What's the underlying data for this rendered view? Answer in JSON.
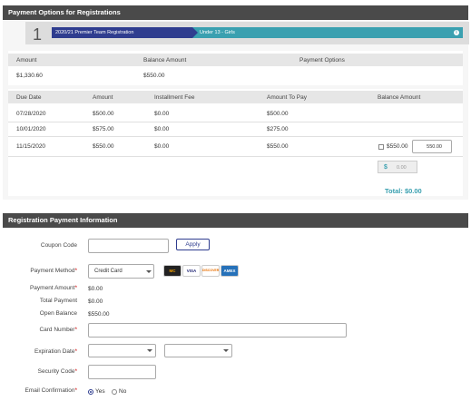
{
  "payment_options": {
    "header": "Payment Options for Registrations",
    "step_number": "1",
    "registration_name": "2020/21 Premier Team Registration",
    "division": "Under 13 - Girls",
    "info_icon": "i",
    "summary_headers": [
      "Amount",
      "Balance Amount",
      "Payment Options"
    ],
    "summary_values": [
      "$1,330.60",
      "$550.00",
      ""
    ],
    "schedule_headers": [
      "Due Date",
      "Amount",
      "Installment Fee",
      "Amount To Pay",
      "Balance Amount"
    ],
    "schedule_rows": [
      {
        "due": "07/28/2020",
        "amount": "$500.00",
        "fee": "$0.00",
        "to_pay": "$500.00"
      },
      {
        "due": "10/01/2020",
        "amount": "$575.00",
        "fee": "$0.00",
        "to_pay": "$275.00"
      },
      {
        "due": "11/15/2020",
        "amount": "$550.00",
        "fee": "$0.00",
        "to_pay": "$550.00"
      }
    ],
    "balance_checkbox_label": "$550.00",
    "balance_input_value": "550.00",
    "dollar_symbol": "$",
    "dollar_value": "0.00",
    "total": "Total: $0.00"
  },
  "registration_payment": {
    "header": "Registration Payment Information",
    "coupon_label": "Coupon Code",
    "coupon_value": "",
    "apply_button": "Apply",
    "payment_method_label": "Payment Method",
    "payment_method_value": "Credit Card",
    "card_logos": [
      "MC",
      "VISA",
      "DISCOVER",
      "AMEX"
    ],
    "payment_amount_label": "Payment Amount",
    "payment_amount_value": "$0.00",
    "total_payment_label": "Total Payment",
    "total_payment_value": "$0.00",
    "open_balance_label": "Open Balance",
    "open_balance_value": "$550.00",
    "card_number_label": "Card Number",
    "card_number_value": "",
    "expiration_label": "Expiration Date",
    "exp_month_value": "",
    "exp_year_value": "",
    "security_code_label": "Security Code",
    "security_code_value": "",
    "email_confirmation_label": "Email Confirmation",
    "email_yes": "Yes",
    "email_no": "No",
    "email_selected": "Yes",
    "required_marker": "*"
  },
  "colors": {
    "header_bg": "#4a4a4a",
    "registration_bar": "#2f3d8f",
    "division_bar": "#3aa0b0",
    "total_text": "#3aa0b0",
    "required": "#cc0000"
  }
}
